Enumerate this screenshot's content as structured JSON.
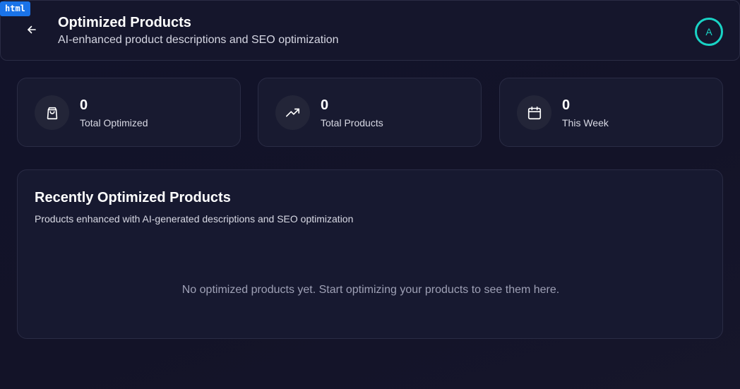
{
  "badge": "html",
  "header": {
    "title": "Optimized Products",
    "subtitle": "AI-enhanced product descriptions and SEO optimization",
    "avatar_initial": "A"
  },
  "stats": [
    {
      "value": "0",
      "label": "Total Optimized",
      "icon": "shopping-bag-icon"
    },
    {
      "value": "0",
      "label": "Total Products",
      "icon": "trending-up-icon"
    },
    {
      "value": "0",
      "label": "This Week",
      "icon": "calendar-icon"
    }
  ],
  "recent": {
    "title": "Recently Optimized Products",
    "subtitle": "Products enhanced with AI-generated descriptions and SEO optimization",
    "empty_message": "No optimized products yet. Start optimizing your products to see them here."
  },
  "colors": {
    "background": "#12132a",
    "card": "#181a30",
    "accent": "#19d3c5",
    "badge": "#1a73e8"
  }
}
